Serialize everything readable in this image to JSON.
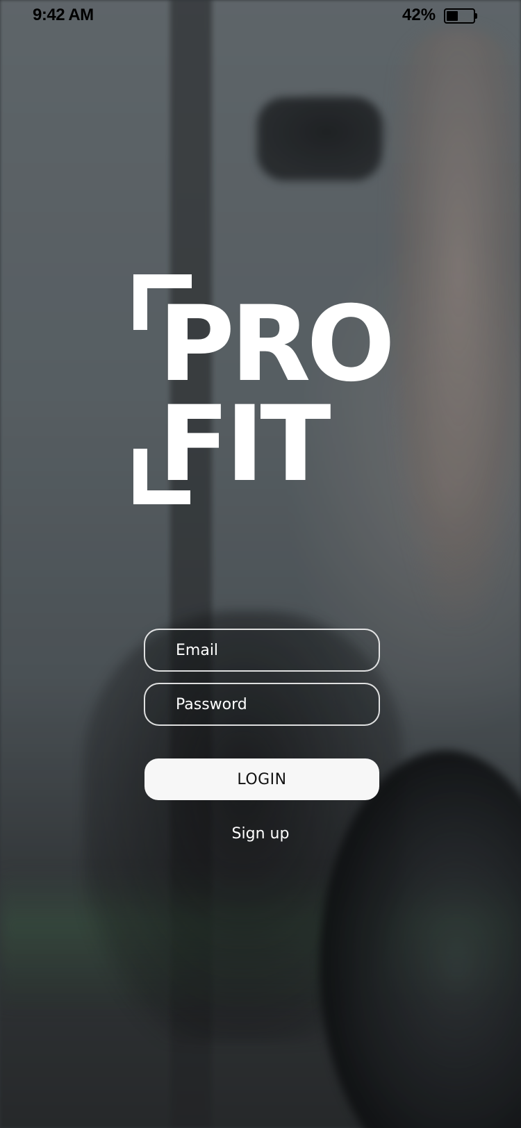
{
  "status_bar": {
    "time": "9:42 AM",
    "battery_percent_label": "42%",
    "battery_level": 0.42,
    "battery_icon": "battery-icon"
  },
  "logo": {
    "line1": "PRO",
    "line2": "FIT",
    "color": "#ffffff"
  },
  "login_form": {
    "email_placeholder": "Email",
    "email_value": "",
    "password_placeholder": "Password",
    "password_value": "",
    "login_label": "LOGIN",
    "signup_label": "Sign up"
  },
  "colors": {
    "button_bg": "#f7f7f7",
    "text_on_bg": "#ffffff",
    "field_border": "#ffffff"
  }
}
